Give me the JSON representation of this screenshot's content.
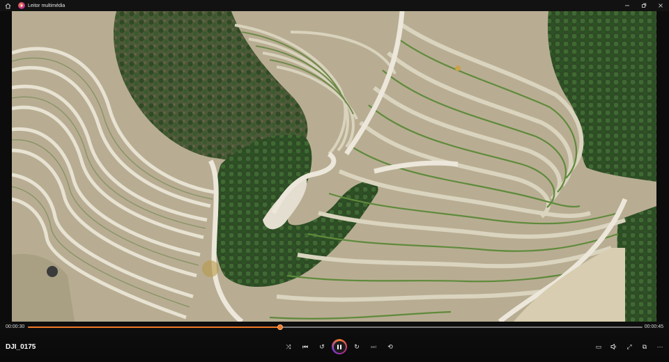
{
  "window": {
    "title": "Leitor multimédia",
    "icons": {
      "home": "home-icon",
      "app": "media-player-app-icon",
      "minimize": "minimize-icon",
      "maximize": "maximize-icon",
      "close": "close-icon"
    }
  },
  "video": {
    "description_icon": "drone-aerial-vineyard-terraces-frame"
  },
  "player": {
    "current_time": "00:00:30",
    "duration": "00:00:45",
    "progress_fraction": 0.41,
    "media_title": "DJI_0175",
    "accent_color": "#f07a28",
    "center_controls": [
      {
        "name": "shuffle-icon",
        "glyph": "⤨",
        "enabled": true
      },
      {
        "name": "previous-icon",
        "glyph": "⏮",
        "enabled": true
      },
      {
        "name": "skip-back-10-icon",
        "glyph": "↺",
        "enabled": true
      },
      {
        "name": "pause-icon",
        "glyph": "",
        "enabled": true
      },
      {
        "name": "skip-forward-30-icon",
        "glyph": "↻",
        "enabled": true
      },
      {
        "name": "next-icon",
        "glyph": "⏭",
        "enabled": false
      },
      {
        "name": "repeat-icon",
        "glyph": "⟲",
        "enabled": true
      }
    ],
    "right_controls": [
      {
        "name": "subtitles-icon",
        "glyph": "▭"
      },
      {
        "name": "volume-icon",
        "glyph": "🔈"
      },
      {
        "name": "fullscreen-icon",
        "glyph": "⤢"
      },
      {
        "name": "miniplayer-icon",
        "glyph": "⧉"
      },
      {
        "name": "more-options-icon",
        "glyph": "⋯"
      }
    ]
  }
}
